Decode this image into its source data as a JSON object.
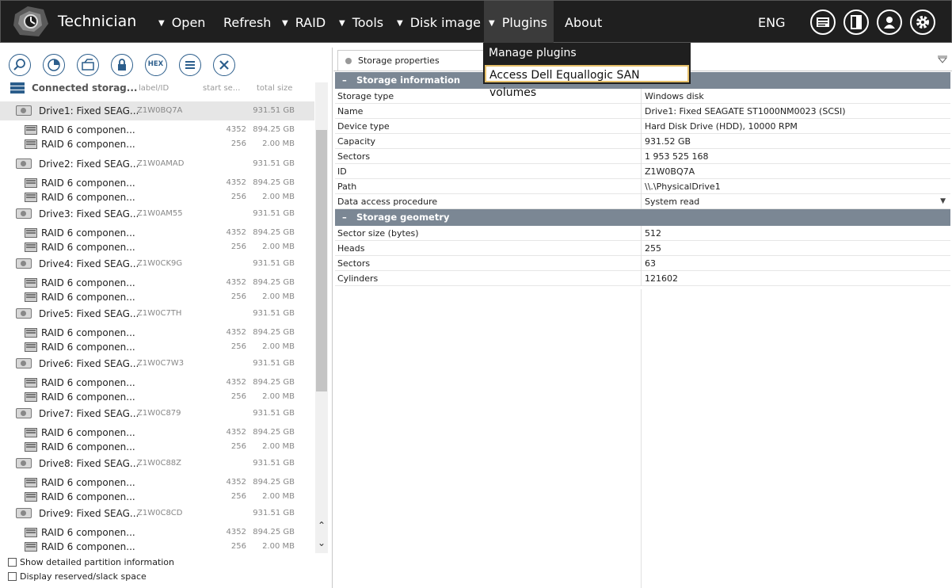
{
  "app": {
    "title": "Technician"
  },
  "menu": {
    "items": [
      {
        "label": "Open",
        "caret": true
      },
      {
        "label": "Refresh",
        "caret": false
      },
      {
        "label": "RAID",
        "caret": true
      },
      {
        "label": "Tools",
        "caret": true
      },
      {
        "label": "Disk image",
        "caret": true
      },
      {
        "label": "Plugins",
        "caret": true,
        "active": true
      },
      {
        "label": "About",
        "caret": false
      }
    ],
    "language": "ENG"
  },
  "dropdown": {
    "items": [
      "Manage plugins",
      "Access Dell Equallogic SAN volumes"
    ]
  },
  "toolbar": {
    "hex_label": "HEX"
  },
  "tree": {
    "header": {
      "title": "Connected storag...",
      "col_label": "label/ID",
      "col_start": "start se...",
      "col_size": "total size"
    },
    "drives": [
      {
        "name": "Drive1: Fixed SEAG...",
        "id": "Z1W0BQ7A",
        "size": "931.51 GB"
      },
      {
        "name": "Drive2: Fixed SEAG...",
        "id": "Z1W0AMAD",
        "size": "931.51 GB"
      },
      {
        "name": "Drive3: Fixed SEAG...",
        "id": "Z1W0AM55",
        "size": "931.51 GB"
      },
      {
        "name": "Drive4: Fixed SEAG...",
        "id": "Z1W0CK9G",
        "size": "931.51 GB"
      },
      {
        "name": "Drive5: Fixed SEAG...",
        "id": "Z1W0C7TH",
        "size": "931.51 GB"
      },
      {
        "name": "Drive6: Fixed SEAG...",
        "id": "Z1W0C7W3",
        "size": "931.51 GB"
      },
      {
        "name": "Drive7: Fixed SEAG...",
        "id": "Z1W0C879",
        "size": "931.51 GB"
      },
      {
        "name": "Drive8: Fixed SEAG...",
        "id": "Z1W0C88Z",
        "size": "931.51 GB"
      },
      {
        "name": "Drive9: Fixed SEAG...",
        "id": "Z1W0C8CD",
        "size": "931.51 GB"
      }
    ],
    "components": [
      {
        "name": "RAID 6 componen...",
        "start": "4352",
        "size": "894.25 GB"
      },
      {
        "name": "RAID 6 componen...",
        "start": "256",
        "size": "2.00 MB"
      }
    ]
  },
  "options": {
    "show_detailed": "Show detailed partition information",
    "display_reserved": "Display reserved/slack space"
  },
  "properties": {
    "tab": "Storage properties",
    "sections": [
      {
        "title": "Storage information",
        "rows": [
          {
            "name": "Storage type",
            "value": "Windows disk"
          },
          {
            "name": "Name",
            "value": "Drive1: Fixed SEAGATE ST1000NM0023 (SCSI)"
          },
          {
            "name": "Device type",
            "value": "Hard Disk Drive (HDD), 10000 RPM"
          },
          {
            "name": "Capacity",
            "value": "931.52 GB"
          },
          {
            "name": "Sectors",
            "value": "1 953 525 168"
          },
          {
            "name": "ID",
            "value": "Z1W0BQ7A"
          },
          {
            "name": "Path",
            "value": "\\\\.\\PhysicalDrive1"
          },
          {
            "name": "Data access procedure",
            "value": "System read",
            "dropdown": true
          }
        ]
      },
      {
        "title": "Storage geometry",
        "rows": [
          {
            "name": "Sector size (bytes)",
            "value": "512"
          },
          {
            "name": "Heads",
            "value": "255"
          },
          {
            "name": "Sectors",
            "value": "63"
          },
          {
            "name": "Cylinders",
            "value": "121602"
          }
        ]
      }
    ]
  },
  "colors": {
    "topbar": "#1f1f1f",
    "section": "#7b8794",
    "accent": "#2c5e8c",
    "highlight_border": "#e6c06a"
  }
}
